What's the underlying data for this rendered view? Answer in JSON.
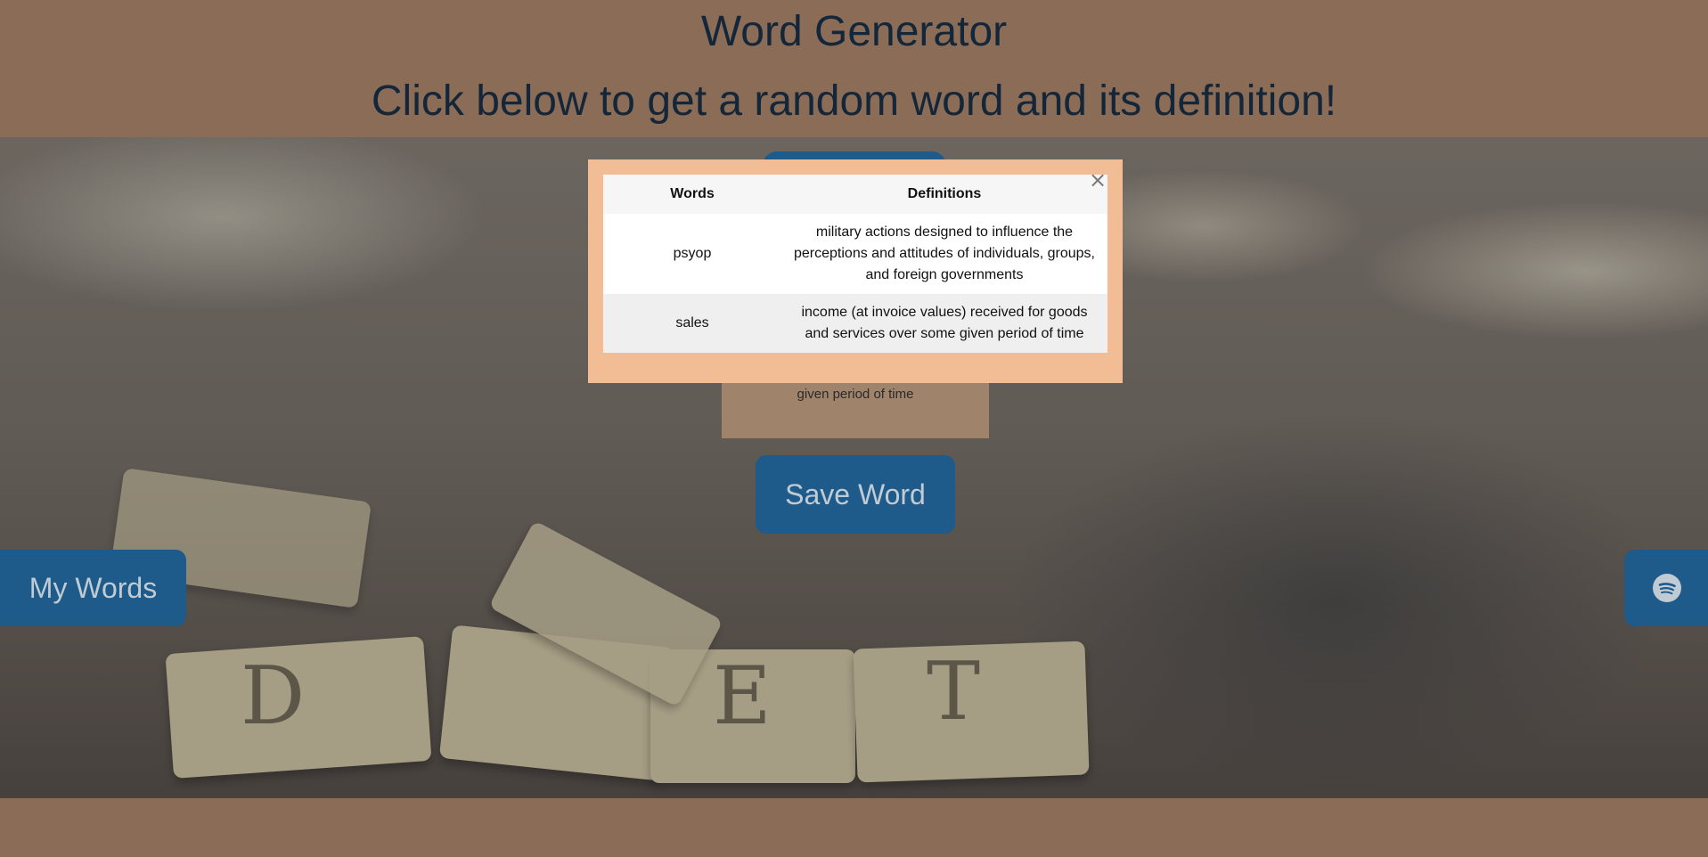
{
  "header": {
    "title": "Word Generator",
    "subtitle": "Click below to get a random word and its definition!"
  },
  "definition_card": {
    "visible_text": "given period of time"
  },
  "buttons": {
    "save_word": "Save Word",
    "my_words": "My Words"
  },
  "modal": {
    "close_symbol": "×",
    "columns": [
      "Words",
      "Definitions"
    ],
    "rows": [
      {
        "word": "psyop",
        "definition": "military actions designed to influence the perceptions and attitudes of individuals, groups, and foreign governments"
      },
      {
        "word": "sales",
        "definition": "income (at invoice values) received for goods and services over some given period of time"
      }
    ]
  },
  "icons": {
    "spotify": "spotify-icon",
    "close": "close-icon"
  },
  "colors": {
    "header_bg": "#8b6d57",
    "button_bg": "#1e5a8a",
    "modal_bg": "#f2bc95",
    "text_dark": "#14263a"
  }
}
